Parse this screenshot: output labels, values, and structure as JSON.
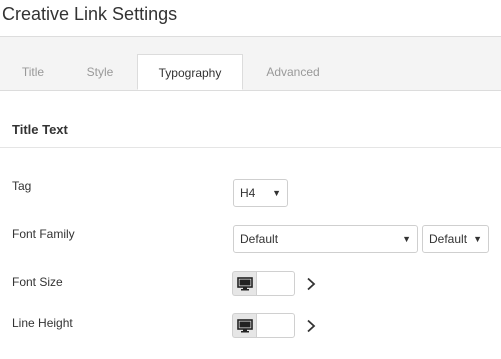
{
  "header": {
    "title": "Creative Link Settings"
  },
  "tabs": [
    {
      "label": "Title"
    },
    {
      "label": "Style"
    },
    {
      "label": "Typography"
    },
    {
      "label": "Advanced"
    }
  ],
  "active_tab": "Typography",
  "section": {
    "title": "Title Text"
  },
  "fields": {
    "tag": {
      "label": "Tag",
      "value": "H4"
    },
    "font_family": {
      "label": "Font Family",
      "value": "Default",
      "weight_value": "Default"
    },
    "font_size": {
      "label": "Font Size",
      "value": ""
    },
    "line_height": {
      "label": "Line Height",
      "value": ""
    }
  },
  "icons": {
    "device": "desktop-icon",
    "expand": "chevron-right-icon",
    "dropdown": "caret-down-icon"
  }
}
